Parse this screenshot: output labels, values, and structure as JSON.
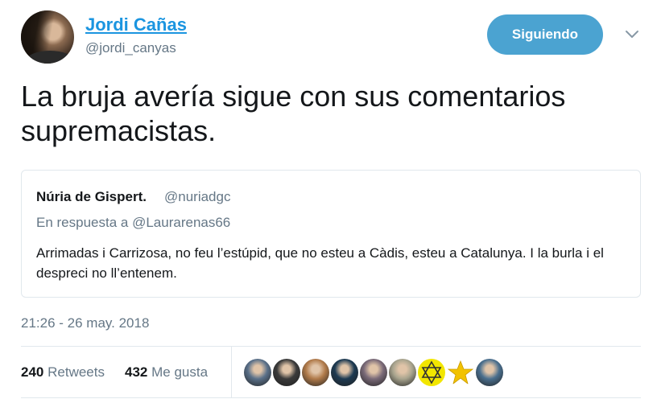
{
  "author": {
    "name": "Jordi Cañas",
    "handle": "@jordi_canyas"
  },
  "follow_button": {
    "label": "Siguiendo",
    "color": "#4ba3d1"
  },
  "tweet": {
    "text": "La bruja avería sigue con sus comentarios supremacistas.",
    "timestamp": "21:26 - 26 may. 2018"
  },
  "quoted_tweet": {
    "name": "Núria de Gispert.",
    "handle": "@nuriadgc",
    "reply_prefix": "En respuesta a",
    "reply_mention": "@Laurarenas66",
    "text": "Arrimadas i Carrizosa, no feu l’estúpid, que no esteu a Càdis, esteu a Catalunya. I la burla i el despreci no ll’entenem."
  },
  "stats": {
    "retweets_count": "240",
    "retweets_label": "Retweets",
    "likes_count": "432",
    "likes_label": "Me gusta"
  },
  "likers": [
    {
      "icon": "avatar-city",
      "color": "#5a7089"
    },
    {
      "icon": "avatar-man",
      "color": "#3a3a3a"
    },
    {
      "icon": "avatar-group",
      "color": "#b07a4a"
    },
    {
      "icon": "avatar-dark",
      "color": "#1d3a52"
    },
    {
      "icon": "avatar-landscape",
      "color": "#7a6a78"
    },
    {
      "icon": "avatar-building",
      "color": "#a8a48e"
    },
    {
      "icon": "star-of-david-badge",
      "color": "#f2e600"
    },
    {
      "icon": "star-badge",
      "color": "#f2c200"
    },
    {
      "icon": "avatar-photo",
      "color": "#4a6f8e"
    }
  ],
  "colors": {
    "link": "#1b95e0",
    "secondary_text": "#657786",
    "primary_text": "#14171a",
    "border": "#e1e8ed"
  }
}
